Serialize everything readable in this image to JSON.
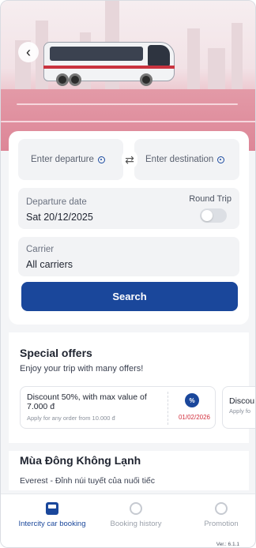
{
  "hero": {
    "back_icon": "chevron-left-icon",
    "back_glyph": "‹"
  },
  "search": {
    "departure_placeholder": "Enter departure",
    "destination_placeholder": "Enter destination",
    "swap_icon": "swap-icon",
    "swap_glyph": "⇄",
    "departure_date_label": "Departure date",
    "departure_date_value": "Sat 20/12/2025",
    "round_trip_label": "Round Trip",
    "round_trip_enabled": false,
    "carrier_label": "Carrier",
    "carrier_value": "All carriers",
    "search_button": "Search"
  },
  "offers": {
    "title": "Special offers",
    "subtitle": "Enjoy your trip with many offers!",
    "items": [
      {
        "title": "Discount 50%, with max value of 7.000 đ",
        "note": "Apply for any order from 10.000 đ",
        "badge": "%",
        "date": "01/02/2026"
      },
      {
        "title": "Discou",
        "note": "Apply fo"
      }
    ]
  },
  "featured": {
    "title": "Mùa Đông Không Lạnh",
    "subtitle": "Everest - Đỉnh núi tuyết của nuối tiếc"
  },
  "bottom_nav": {
    "items": [
      {
        "label": "Intercity car booking",
        "icon": "bus-icon",
        "active": true
      },
      {
        "label": "Booking history",
        "icon": "history-icon",
        "active": false
      },
      {
        "label": "Promotion",
        "icon": "promotion-icon",
        "active": false
      }
    ],
    "version": "Ver.: 6.1.1"
  },
  "colors": {
    "primary": "#1a479b",
    "accent_red": "#d2303d",
    "hero_pink": "#e29aa7"
  }
}
